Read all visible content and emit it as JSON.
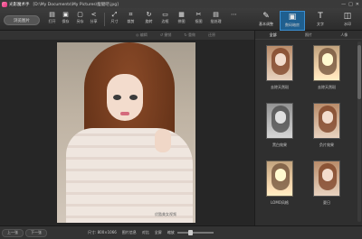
{
  "window": {
    "app_name": "光影魔术手",
    "path": "[D:\\My Documents\\My Pictures\\瘦腿吧.jpg]",
    "controls": [
      "—",
      "□",
      "✕"
    ]
  },
  "toolbar": {
    "open_label": "浏览图片",
    "tools": [
      {
        "label": "打开",
        "icon": "▤",
        "name": "open"
      },
      {
        "label": "保存",
        "icon": "▣",
        "name": "save"
      },
      {
        "label": "另存",
        "icon": "▢",
        "name": "save-as"
      },
      {
        "label": "分享",
        "icon": "<",
        "name": "share"
      },
      {
        "label": "尺寸",
        "icon": "⤢",
        "name": "resize"
      },
      {
        "label": "裁剪",
        "icon": "⌗",
        "name": "crop"
      },
      {
        "label": "旋转",
        "icon": "↻",
        "name": "rotate"
      },
      {
        "label": "边框",
        "icon": "▭",
        "name": "border"
      },
      {
        "label": "拼图",
        "icon": "▦",
        "name": "collage"
      },
      {
        "label": "抠图",
        "icon": "✂",
        "name": "cutout"
      },
      {
        "label": "批处理",
        "icon": "▤",
        "name": "batch"
      }
    ],
    "panel_tabs": [
      {
        "label": "基本调整",
        "icon": "✎",
        "name": "basic-adjust"
      },
      {
        "label": "数码暗房",
        "icon": "▣",
        "name": "digital-darkroom"
      },
      {
        "label": "文字",
        "icon": "T",
        "name": "text"
      },
      {
        "label": "水印",
        "icon": "◫",
        "name": "watermark"
      }
    ]
  },
  "subbar": {
    "items": [
      "◎ 编辑",
      "↺ 撤销",
      "↻ 重做",
      "还原"
    ]
  },
  "panel": {
    "categories": [
      "全部",
      "照片",
      "人像"
    ],
    "effects": [
      {
        "label": "去除天然斑",
        "style": "normal"
      },
      {
        "label": "去除天然斑",
        "style": "warm"
      },
      {
        "label": "黑白效果",
        "style": "bw"
      },
      {
        "label": "负片效果",
        "style": "normal"
      },
      {
        "label": "LOMO风格",
        "style": "warm"
      },
      {
        "label": "夏日",
        "style": "normal"
      }
    ]
  },
  "bottombar": {
    "prev": "上一张",
    "next": "下一张",
    "size": "尺寸: 800×1066",
    "info": "图片信息",
    "compare": "对比",
    "fit": "全屏",
    "zoom_label": "缩放",
    "zoom_value": 0.3,
    "photo_watermark": "优酷美女视频"
  }
}
